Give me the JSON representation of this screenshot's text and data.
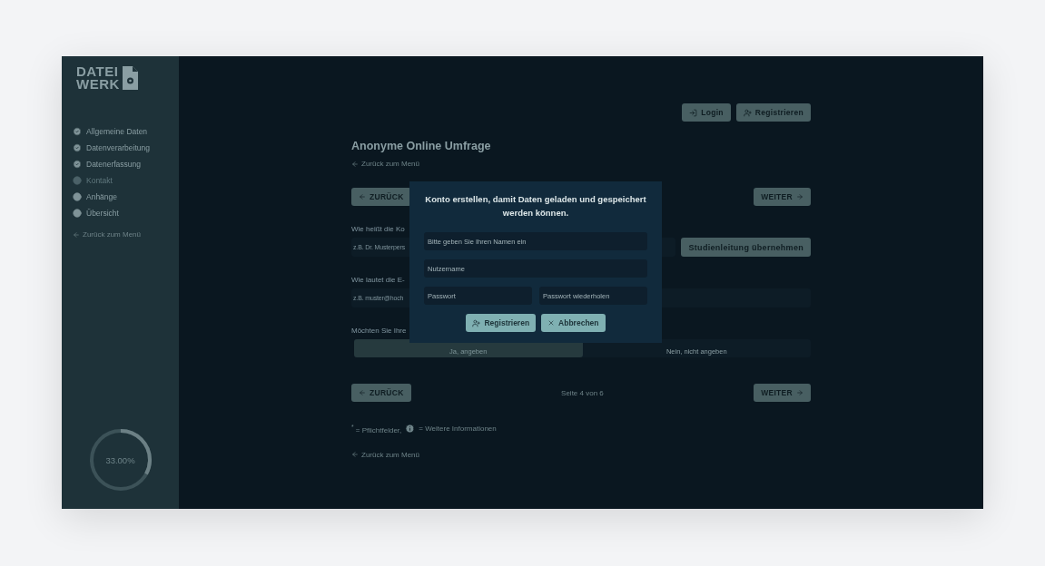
{
  "logo": {
    "line_1": "DATEI",
    "line_2": "WERK"
  },
  "sidebar": {
    "steps": [
      {
        "label": "Allgemeine Daten",
        "done": true,
        "selected": false
      },
      {
        "label": "Datenverarbeitung",
        "done": true,
        "selected": false
      },
      {
        "label": "Datenerfassung",
        "done": true,
        "selected": false
      },
      {
        "label": "Kontakt",
        "done": false,
        "selected": true
      },
      {
        "label": "Anhänge",
        "done": false,
        "selected": false
      },
      {
        "label": "Übersicht",
        "done": false,
        "selected": false
      }
    ],
    "back_link": "Zurück zum Menü",
    "progress": {
      "level": 0.33,
      "reading": "33.00%"
    }
  },
  "header": {
    "login": "Login",
    "register": "Registrieren"
  },
  "page": {
    "title": "Anonyme Online Umfrage",
    "back_link": "Zurück zum Menü"
  },
  "nav_top": {
    "back": "ZURÜCK",
    "next": "WEITER"
  },
  "questions": [
    {
      "kind": "text",
      "label": "Wie heißt die Ko",
      "placeholder": "z.B. Dr. Musterpers",
      "button": "Studienleitung übernehmen"
    },
    {
      "kind": "text",
      "label": "Wie lautet die E-",
      "placeholder": "z.B. muster@hoch"
    },
    {
      "kind": "choice",
      "label": "Möchten Sie Ihre",
      "options": [
        {
          "label": "Ja, angeben",
          "selected": true
        },
        {
          "label": "Nein, nicht angeben",
          "selected": false
        }
      ]
    }
  ],
  "nav_bottom": {
    "back": "ZURÜCK",
    "page": "Seite 4 von 6",
    "next": "WEITER"
  },
  "legend": {
    "required": "$^{*}$ = Pflichtfelder,",
    "info": "= Weitere Informationen"
  },
  "footer_link": "Zurück zum Menü",
  "modal": {
    "title": "Konto erstellen, damit Daten geladen und gespeichert werden können.",
    "fields": [
      {
        "placeholder": "Bitte geben Sie Ihren Namen ein"
      },
      {
        "placeholder": "Nutzername"
      },
      {
        "placeholder": "Passwort"
      },
      {
        "placeholder": "Passwort wiederholen"
      }
    ],
    "register": "Registrieren",
    "cancel": "Abbrechen"
  }
}
